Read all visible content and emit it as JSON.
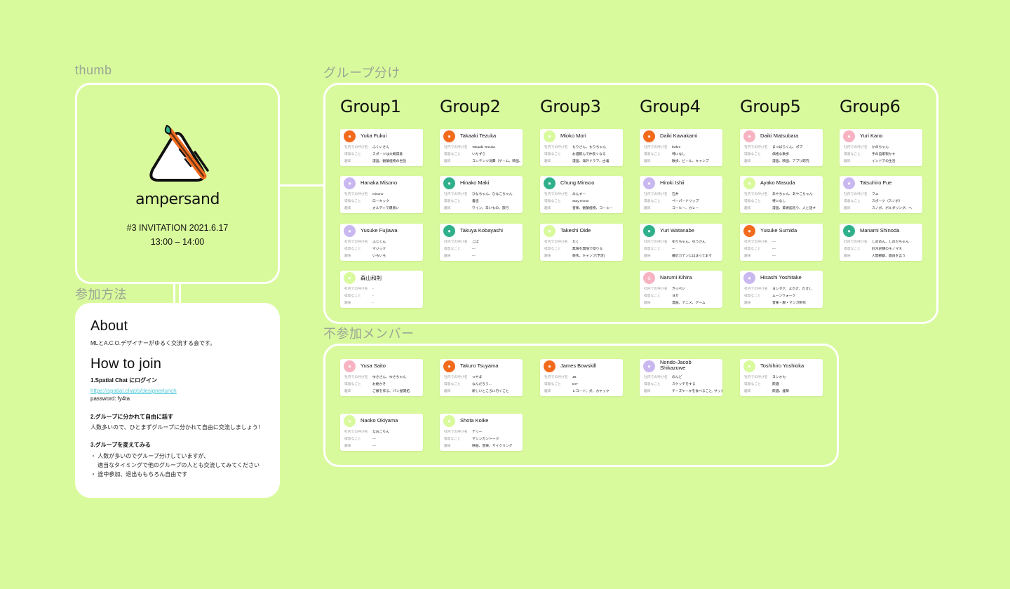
{
  "labels": {
    "thumb": "thumb",
    "groups": "グループ分け",
    "join": "参加方法",
    "absent": "不参加メンバー"
  },
  "thumb": {
    "logo_text": "ampersand",
    "event_title": "#3 INVITATION 2021.6.17",
    "event_time": "13:00 – 14:00"
  },
  "info": {
    "about_title": "About",
    "about_text": "MLとA.C.O.デザイナーがゆるく交流する会です。",
    "join_title": "How to join",
    "step1_title": "1.Spatial Chat にログイン",
    "step1_link": "https://spatial.chat/s/designerlunch",
    "step1_password": "password: fy4ta",
    "step2_title": "2.グループに分かれて自由に話す",
    "step2_text": "人数多いので、ひとまずグループに分かれて自由に交流しましょう！",
    "step3_title": "3.グループを変えてみる",
    "step3_bullet1": "・ 人数が多いのでグループ分けしていますが、",
    "step3_bullet1b": "適当なタイミングで他のグループの人とも交流してみてください",
    "step3_bullet2": "・ 途中参加、退出ももちろん自由です"
  },
  "field_labels": {
    "nickname": "社内での呼び名",
    "skill": "得意なこと",
    "hobby": "趣味"
  },
  "colors": {
    "background": "#d9fa9c",
    "frame": "#ffffff",
    "link": "#52c9d9"
  },
  "groups": [
    {
      "title": "Group1",
      "members": [
        {
          "name": "Yuka Fukui",
          "nickname": "ふくいさん",
          "skill": "スポーツは大概得意",
          "hobby": "漫画、観葉植物の世話",
          "avatar_color": "#f26b1d",
          "avatar_icon": "cat-icon"
        },
        {
          "name": "Hanaka Misono",
          "nickname": "misono",
          "skill": "ローキック",
          "hobby": "カルディで爆買い",
          "avatar_color": "#c9b8f0",
          "avatar_icon": "kiwi-icon"
        },
        {
          "name": "Yusuke Fujiawa",
          "nickname": "ふじくん",
          "skill": "マジック",
          "hobby": "いろいろ",
          "avatar_color": "#c9b8f0",
          "avatar_icon": "cat-icon"
        },
        {
          "name": "森山和則",
          "nickname": "-",
          "skill": "-",
          "hobby": "-",
          "avatar_color": "#d9fa9c",
          "avatar_icon": "kiwi-icon"
        }
      ]
    },
    {
      "title": "Group2",
      "members": [
        {
          "name": "Takaaki Tezuka",
          "nickname": "Takaaki Tezuka",
          "skill": "いたずら",
          "hobby": "コンテンツ消費（ゲーム、映画、ネットフ",
          "avatar_color": "#f26b1d",
          "avatar_icon": "burger-icon"
        },
        {
          "name": "Hinako Maki",
          "nickname": "ひなちゃん、ひなこちゃん",
          "skill": "書道",
          "hobby": "ワイン、辛いもの、旅行",
          "avatar_color": "#2fb08a",
          "avatar_icon": "cocktail-icon"
        },
        {
          "name": "Takuya Kobayashi",
          "nickname": "こば",
          "skill": "---",
          "hobby": "---",
          "avatar_color": "#2fb08a",
          "avatar_icon": "bowl-icon"
        }
      ]
    },
    {
      "title": "Group3",
      "members": [
        {
          "name": "Mioko Mori",
          "nickname": "もりさん、もりちゃん",
          "skill": "お酒飲んで仲良くなる",
          "hobby": "漫画、海外ドラマ、古着",
          "avatar_color": "#d9fa9c",
          "avatar_icon": "cat-icon"
        },
        {
          "name": "Chung Minsoo",
          "nickname": "みんすー",
          "skill": "Stay Home",
          "hobby": "音楽、観葉植物、コーヒー",
          "avatar_color": "#2fb08a",
          "avatar_icon": "tree-icon"
        },
        {
          "name": "Takeshi Oide",
          "nickname": "たく",
          "skill": "無限を無限で得りる",
          "hobby": "競馬、キャンプ(予定)",
          "avatar_color": "#d9fa9c",
          "avatar_icon": "cat-icon"
        }
      ]
    },
    {
      "title": "Group4",
      "members": [
        {
          "name": "Daiki Kawakami",
          "nickname": "kwkm",
          "skill": "特になし",
          "hobby": "散歩、ビール、キャンプ",
          "avatar_color": "#f26b1d",
          "avatar_icon": "cat-icon"
        },
        {
          "name": "Hiroki Ishii",
          "nickname": "石井",
          "skill": "ペーパードリップ",
          "hobby": "コーヒー、カレー",
          "avatar_color": "#c9b8f0",
          "avatar_icon": "octopus-icon"
        },
        {
          "name": "Yuri Watanabe",
          "nickname": "ゆりちゃん、ゆうさん",
          "skill": "---",
          "hobby": "最近カテンにはまってます",
          "avatar_color": "#2fb08a",
          "avatar_icon": "cat-icon"
        },
        {
          "name": "Narumi Kihira",
          "nickname": "きっぺい",
          "skill": "ヨガ",
          "hobby": "漫画、アニメ、ゲーム",
          "avatar_color": "#f7b3c2",
          "avatar_icon": "letter-icon"
        }
      ]
    },
    {
      "title": "Group5",
      "members": [
        {
          "name": "Daiki Matsubara",
          "nickname": "まつばらくん、ポプ",
          "skill": "価格な散歩",
          "hobby": "漫画、映画、アプリ研究",
          "avatar_color": "#f7b3c2",
          "avatar_icon": "cat-icon"
        },
        {
          "name": "Ayako Masuda",
          "nickname": "あやちゃん、あやこちゃん",
          "skill": "特になし",
          "hobby": "漫画、美術館巡り、人と話す",
          "avatar_color": "#d9fa9c",
          "avatar_icon": "cat-icon"
        },
        {
          "name": "Yusuke Sumida",
          "nickname": "---",
          "skill": "---",
          "hobby": "---",
          "avatar_color": "#f26b1d",
          "avatar_icon": "cat-icon"
        },
        {
          "name": "Hisashi Yoshitake",
          "nickname": "ヨシタケ、よたけ、たけし",
          "skill": "ムーンウォーク",
          "hobby": "音楽・服・マンガ制作",
          "avatar_color": "#c9b8f0",
          "avatar_icon": "burger-icon"
        }
      ]
    },
    {
      "title": "Group6",
      "members": [
        {
          "name": "Yuri Kano",
          "nickname": "かのちゃん",
          "skill": "手の自家製かす",
          "hobby": "インドアの生活",
          "avatar_color": "#f7b3c2",
          "avatar_icon": "burger-icon"
        },
        {
          "name": "Tatsuhiro Fue",
          "nickname": "フエ",
          "skill": "スポーツ（スノボ）",
          "hobby": "スノボ、ボルダリング、ヘ",
          "avatar_color": "#c9b8f0",
          "avatar_icon": "cat-icon"
        },
        {
          "name": "Manami Shinoda",
          "nickname": "しのめん、しのだちゃん",
          "skill": "鈴木史朗のモノマネ",
          "hobby": "人間観察、面白を言う",
          "avatar_color": "#2fb08a",
          "avatar_icon": "burger-icon"
        }
      ]
    }
  ],
  "absent": [
    {
      "name": "Yusa Saito",
      "nickname": "ゆささん、ゆさちゃん",
      "skill": "お絵かき",
      "hobby": "ご飯を作る、パン屋開拓",
      "avatar_color": "#f7b3c2",
      "avatar_icon": "cat-icon"
    },
    {
      "name": "Takuro Tsuyama",
      "nickname": "つやま",
      "skill": "なんだろう...",
      "hobby": "新しいところに行くこと",
      "avatar_color": "#f26b1d",
      "avatar_icon": "cat-icon"
    },
    {
      "name": "James Bowskill",
      "nickname": "JB",
      "skill": "DIY",
      "hobby": "レコード、犬、カヤック",
      "avatar_color": "#f26b1d",
      "avatar_icon": "bowl-icon"
    },
    {
      "name": "Nondo-Jacob Shikazuwe",
      "nickname": "のんど",
      "skill": "スケッチをする",
      "hobby": "チーズケーキを食べること, サッカー",
      "avatar_color": "#c9b8f0",
      "avatar_icon": "burger-icon"
    },
    {
      "name": "Toshihiro Yoshioka",
      "nickname": "ヨシオカ",
      "skill": "飲酒",
      "hobby": "飲酒、煙草",
      "avatar_color": "#d9fa9c",
      "avatar_icon": "drink-icon"
    },
    {
      "name": "Naoko Okiyama",
      "nickname": "なおこりん",
      "skill": "---",
      "hobby": "---",
      "avatar_color": "#d9fa9c",
      "avatar_icon": "kiwi-icon"
    },
    {
      "name": "Shota Koike",
      "nickname": "テリー",
      "skill": "マシンガントーク",
      "hobby": "映画、音楽、サイクリング",
      "avatar_color": "#d9fa9c",
      "avatar_icon": "frog-icon"
    }
  ]
}
